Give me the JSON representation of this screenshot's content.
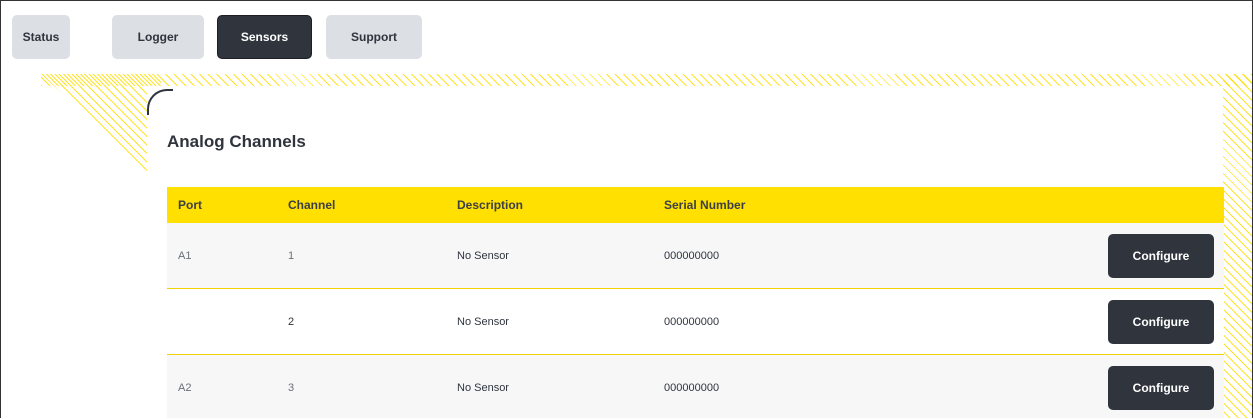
{
  "tabs": [
    {
      "label": "Status",
      "active": false
    },
    {
      "label": "Logger",
      "active": false
    },
    {
      "label": "Sensors",
      "active": true
    },
    {
      "label": "Support",
      "active": false
    }
  ],
  "section": {
    "title": "Analog Channels"
  },
  "table": {
    "headers": [
      "Port",
      "Channel",
      "Description",
      "Serial Number"
    ],
    "rows": [
      {
        "port": "A1",
        "channel": "1",
        "description": "No Sensor",
        "serial": "000000000",
        "action": "Configure"
      },
      {
        "port": "",
        "channel": "2",
        "description": "No Sensor",
        "serial": "000000000",
        "action": "Configure"
      },
      {
        "port": "A2",
        "channel": "3",
        "description": "No Sensor",
        "serial": "000000000",
        "action": "Configure"
      }
    ]
  },
  "colors": {
    "accent": "#ffe000",
    "dark": "#2f343d",
    "tab_inactive": "#dcdfe4",
    "row_shaded": "#f7f7f8"
  }
}
